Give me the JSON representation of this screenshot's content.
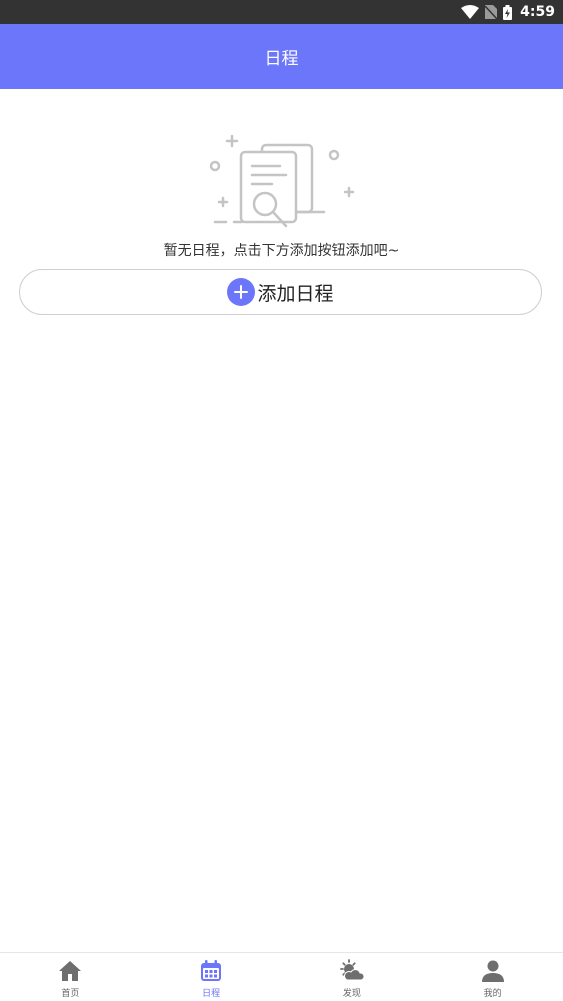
{
  "status_bar": {
    "time": "4:59"
  },
  "app_bar": {
    "title": "日程"
  },
  "empty_state": {
    "illustration": "document-search-icon",
    "message": "暂无日程，点击下方添加按钮添加吧~"
  },
  "add_button": {
    "icon": "plus-icon",
    "label": "添加日程"
  },
  "bottom_nav": {
    "items": [
      {
        "label": "首页",
        "icon": "home-icon",
        "active": false
      },
      {
        "label": "日程",
        "icon": "calendar-icon",
        "active": true
      },
      {
        "label": "发现",
        "icon": "weather-icon",
        "active": false
      },
      {
        "label": "我的",
        "icon": "person-icon",
        "active": false
      }
    ]
  },
  "colors": {
    "accent": "#6c76fb",
    "status_bar": "#333333",
    "inactive": "#666666"
  }
}
